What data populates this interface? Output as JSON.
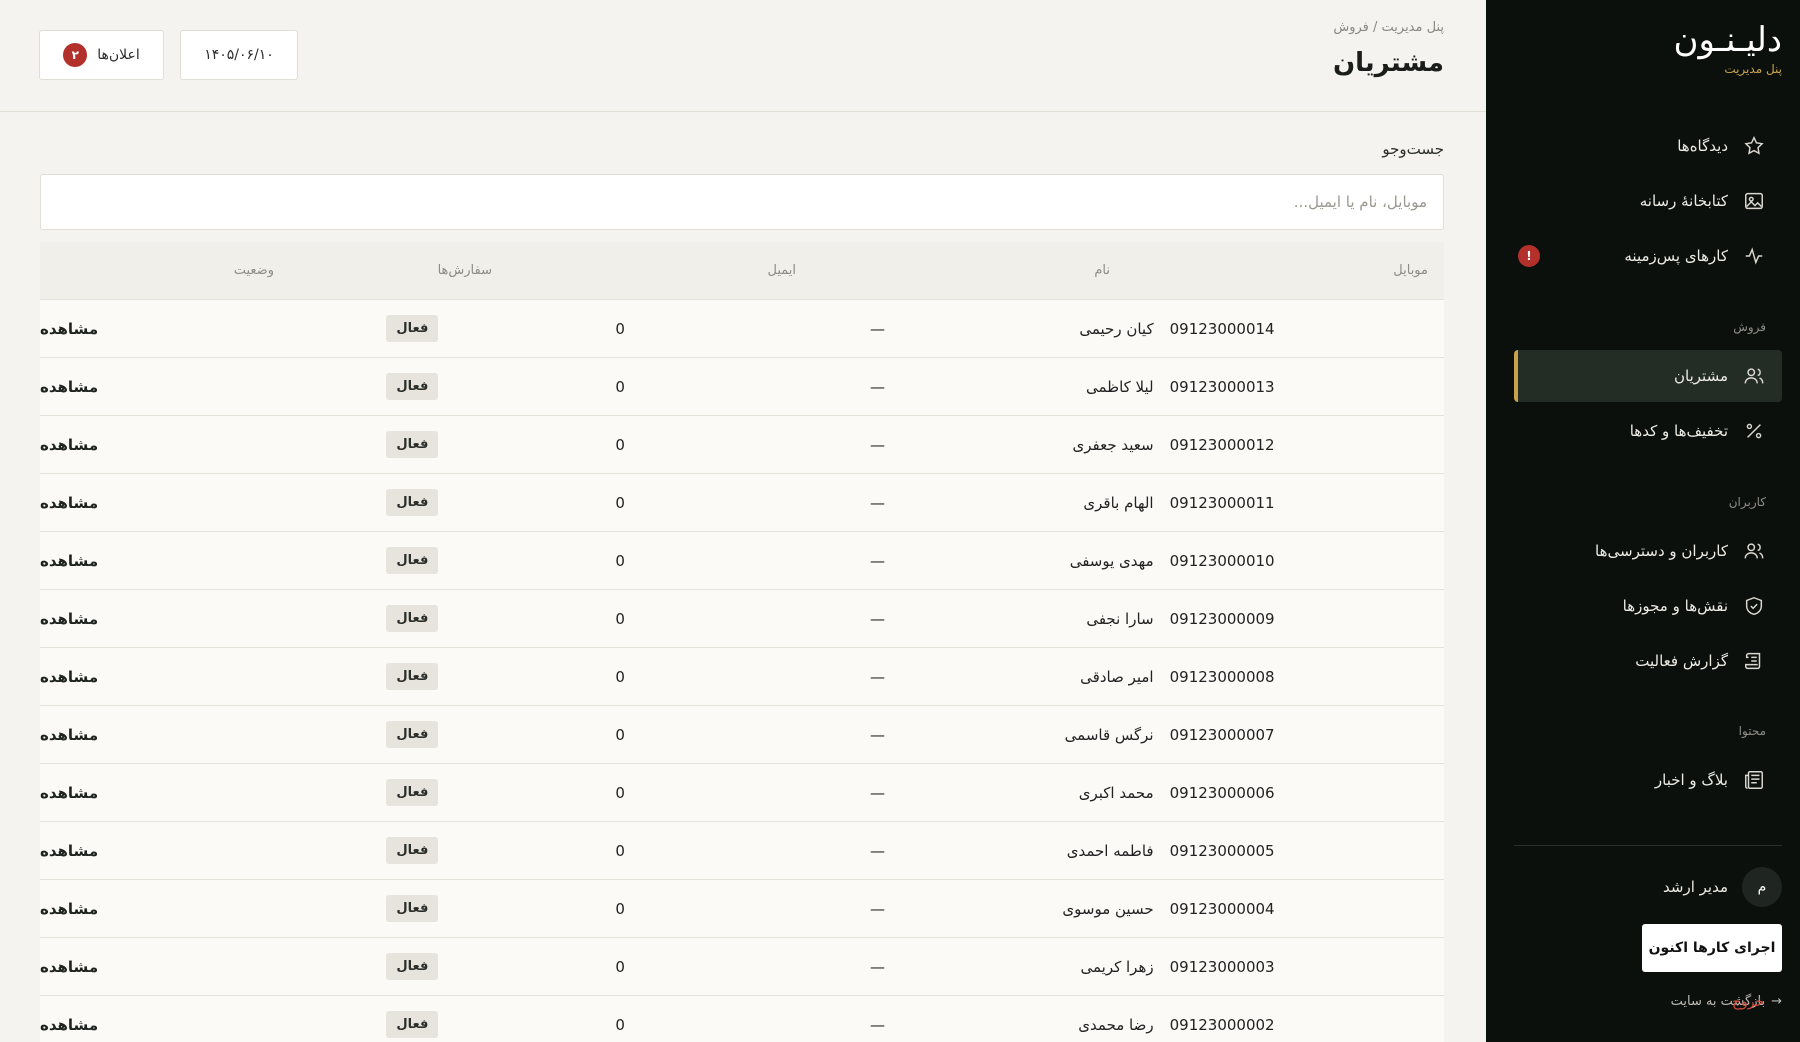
{
  "sidebar": {
    "brand": "دلیـنـون",
    "brand_sub": "پنل مدیریت",
    "items": [
      {
        "label": "دیدگاه‌ها",
        "icon": "star-icon"
      },
      {
        "label": "کتابخانهٔ رسانه",
        "icon": "image-icon"
      },
      {
        "label": "کارهای پس‌زمینه",
        "icon": "activity-icon",
        "badge": "!"
      },
      {
        "label": "مشتریان",
        "icon": "users-icon",
        "active": true
      },
      {
        "label": "تخفیف‌ها و کدها",
        "icon": "percent-icon"
      },
      {
        "label": "کاربران و دسترسی‌ها",
        "icon": "users-icon"
      },
      {
        "label": "نقش‌ها و مجوزها",
        "icon": "shield-icon"
      },
      {
        "label": "گزارش فعالیت",
        "icon": "scroll-icon"
      },
      {
        "label": "بلاگ و اخبار",
        "icon": "newspaper-icon"
      }
    ],
    "sections": {
      "sales": "فروش",
      "users": "کاربران",
      "content": "محتوا"
    },
    "user": {
      "initial": "م",
      "name": "مدیر ارشد"
    },
    "run_jobs": "اجرای کارها اکنون",
    "back_to_site": "بازگشت به سایت",
    "logout": "خروج"
  },
  "header": {
    "breadcrumb": "پنل مدیریت / فروش",
    "title": "مشتریان",
    "date": "۱۴۰۵/۰۶/۱۰",
    "notifications_label": "اعلان‌ها",
    "notifications_count": "۲"
  },
  "search": {
    "label": "جست‌وجو",
    "placeholder": "موبایل، نام یا ایمیل..."
  },
  "table": {
    "columns": {
      "mobile": "موبایل",
      "name": "نام",
      "email": "ایمیل",
      "orders": "سفارش‌ها",
      "status": "وضعیت"
    },
    "rows": [
      {
        "mobile": "09123000014",
        "name": "کیان رحیمی",
        "email": "—",
        "orders": "0",
        "status": "فعال",
        "action": "مشاهده"
      },
      {
        "mobile": "09123000013",
        "name": "لیلا کاظمی",
        "email": "—",
        "orders": "0",
        "status": "فعال",
        "action": "مشاهده"
      },
      {
        "mobile": "09123000012",
        "name": "سعید جعفری",
        "email": "—",
        "orders": "0",
        "status": "فعال",
        "action": "مشاهده"
      },
      {
        "mobile": "09123000011",
        "name": "الهام باقری",
        "email": "—",
        "orders": "0",
        "status": "فعال",
        "action": "مشاهده"
      },
      {
        "mobile": "09123000010",
        "name": "مهدی یوسفی",
        "email": "—",
        "orders": "0",
        "status": "فعال",
        "action": "مشاهده"
      },
      {
        "mobile": "09123000009",
        "name": "سارا نجفی",
        "email": "—",
        "orders": "0",
        "status": "فعال",
        "action": "مشاهده"
      },
      {
        "mobile": "09123000008",
        "name": "امیر صادقی",
        "email": "—",
        "orders": "0",
        "status": "فعال",
        "action": "مشاهده"
      },
      {
        "mobile": "09123000007",
        "name": "نرگس قاسمی",
        "email": "—",
        "orders": "0",
        "status": "فعال",
        "action": "مشاهده"
      },
      {
        "mobile": "09123000006",
        "name": "محمد اکبری",
        "email": "—",
        "orders": "0",
        "status": "فعال",
        "action": "مشاهده"
      },
      {
        "mobile": "09123000005",
        "name": "فاطمه احمدی",
        "email": "—",
        "orders": "0",
        "status": "فعال",
        "action": "مشاهده"
      },
      {
        "mobile": "09123000004",
        "name": "حسین موسوی",
        "email": "—",
        "orders": "0",
        "status": "فعال",
        "action": "مشاهده"
      },
      {
        "mobile": "09123000003",
        "name": "زهرا کریمی",
        "email": "—",
        "orders": "0",
        "status": "فعال",
        "action": "مشاهده"
      },
      {
        "mobile": "09123000002",
        "name": "رضا محمدی",
        "email": "—",
        "orders": "0",
        "status": "فعال",
        "action": "مشاهده"
      }
    ]
  }
}
